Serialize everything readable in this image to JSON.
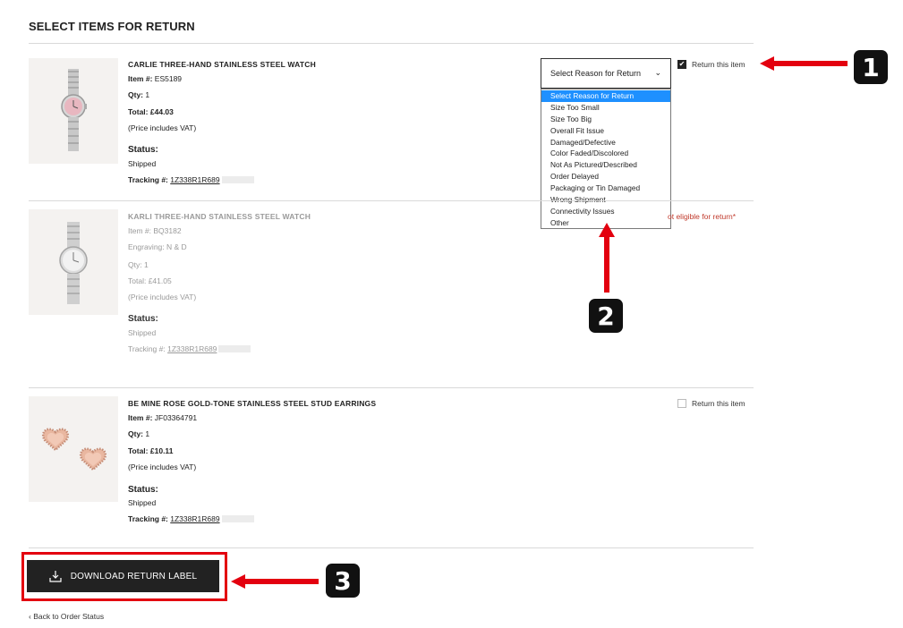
{
  "page": {
    "title": "SELECT ITEMS FOR RETURN"
  },
  "items": [
    {
      "name": "CARLIE THREE-HAND STAINLESS STEEL WATCH",
      "item_label": "Item #:",
      "item_number": "ES5189",
      "qty_label": "Qty:",
      "qty": "1",
      "total_label": "Total:",
      "total": "£44.03",
      "vat_note": "(Price includes VAT)",
      "status_label": "Status:",
      "status": "Shipped",
      "tracking_label": "Tracking #:",
      "tracking": "1Z338R1R689",
      "return_label": "Return this item",
      "return_checked": true,
      "image_icon": "watch-pink-dial"
    },
    {
      "name": "KARLI THREE-HAND STAINLESS STEEL WATCH",
      "item_label": "Item #:",
      "item_number": "BQ3182",
      "engraving_label": "Engraving:",
      "engraving": "N & D",
      "qty_label": "Qty:",
      "qty": "1",
      "total_label": "Total:",
      "total": "£41.05",
      "vat_note": "(Price includes VAT)",
      "status_label": "Status:",
      "status": "Shipped",
      "tracking_label": "Tracking #:",
      "tracking": "1Z338R1R689",
      "not_eligible": "ot eligible for return*",
      "image_icon": "watch-silver-dial"
    },
    {
      "name": "BE MINE ROSE GOLD-TONE STAINLESS STEEL STUD EARRINGS",
      "item_label": "Item #:",
      "item_number": "JF03364791",
      "qty_label": "Qty:",
      "qty": "1",
      "total_label": "Total:",
      "total": "£10.11",
      "vat_note": "(Price includes VAT)",
      "status_label": "Status:",
      "status": "Shipped",
      "tracking_label": "Tracking #:",
      "tracking": "1Z338R1R689",
      "return_label": "Return this item",
      "return_checked": false,
      "image_icon": "heart-earrings"
    }
  ],
  "reason_select": {
    "selected": "Select Reason for Return",
    "options": [
      "Select Reason for Return",
      "Size Too Small",
      "Size Too Big",
      "Overall Fit Issue",
      "Damaged/Defective",
      "Color Faded/Discolored",
      "Not As Pictured/Described",
      "Order Delayed",
      "Packaging or Tin Damaged",
      "Wrong Shipment",
      "Connectivity Issues",
      "Other"
    ]
  },
  "actions": {
    "download_label": "DOWNLOAD RETURN LABEL",
    "back_label": "Back to Order Status"
  },
  "annotations": {
    "badges": [
      "1",
      "2",
      "3"
    ],
    "color": "#e3000f"
  },
  "colors": {
    "primary_button": "#222222",
    "highlight": "#1e90ff",
    "error": "#c0392b"
  }
}
